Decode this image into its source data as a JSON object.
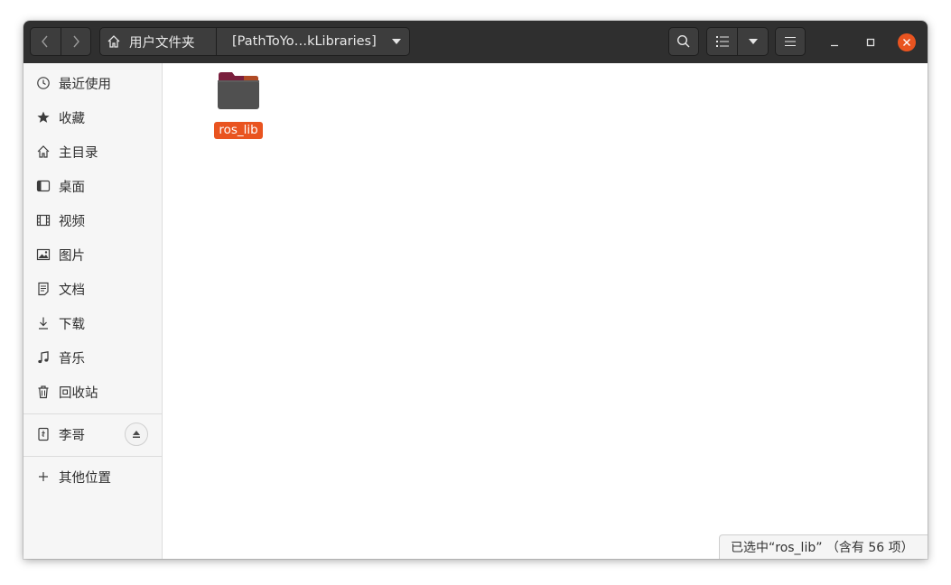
{
  "path": {
    "home_label": "用户文件夹",
    "current_label": "[PathToYo…kLibraries]"
  },
  "sidebar": {
    "items": [
      {
        "label": "最近使用",
        "icon": "clock-icon"
      },
      {
        "label": "收藏",
        "icon": "star-icon"
      },
      {
        "label": "主目录",
        "icon": "home-icon"
      },
      {
        "label": "桌面",
        "icon": "desktop-icon"
      },
      {
        "label": "视频",
        "icon": "video-icon"
      },
      {
        "label": "图片",
        "icon": "picture-icon"
      },
      {
        "label": "文档",
        "icon": "document-icon"
      },
      {
        "label": "下载",
        "icon": "download-icon"
      },
      {
        "label": "音乐",
        "icon": "music-icon"
      },
      {
        "label": "回收站",
        "icon": "trash-icon"
      }
    ],
    "device": {
      "label": "李哥",
      "icon": "usb-drive-icon"
    },
    "other_locations": {
      "label": "其他位置",
      "icon": "plus-icon"
    }
  },
  "files": [
    {
      "name": "ros_lib",
      "type": "folder",
      "selected": true
    }
  ],
  "status": {
    "text": "已选中“ros_lib” （含有 56 项）"
  },
  "colors": {
    "accent": "#e95420",
    "headerbar": "#2f2f2f",
    "folder_body": "#505050",
    "folder_tab": "#7a1f3d"
  }
}
